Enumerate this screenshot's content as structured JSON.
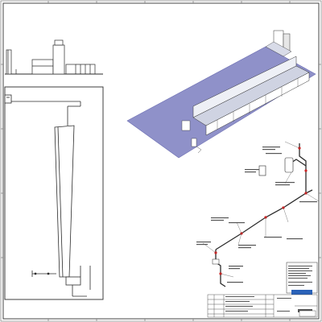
{
  "drawing": {
    "top_grid_labels": [],
    "side_grid_labels": [],
    "title_block": {
      "company_logo_text": "",
      "sheet_id": "",
      "revision_rows": []
    },
    "callouts": [],
    "colors": {
      "border": "#333333",
      "line": "#2b2b2b",
      "floor": "#8f91c9",
      "floor_edge": "#6e70b3",
      "pipe_red": "#cc2222",
      "logo_blue": "#2a62b8",
      "leader": "#444444"
    },
    "icons": [
      "floor-plan-drawing",
      "side-elevation-drawing",
      "isometric-building",
      "isometric-piping"
    ]
  }
}
